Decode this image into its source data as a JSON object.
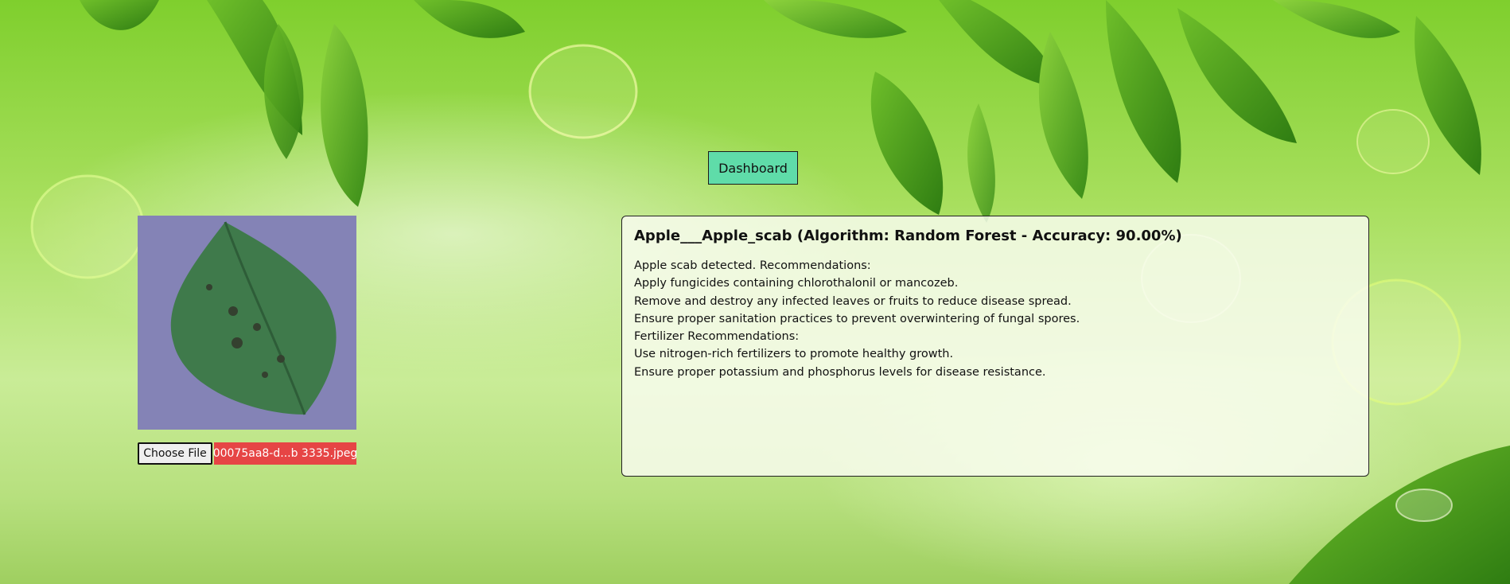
{
  "header": {
    "dashboard_label": "Dashboard"
  },
  "upload": {
    "choose_file_label": "Choose File",
    "file_name": "00075aa8-d...b 3335.jpeg"
  },
  "result": {
    "title": "Apple___Apple_scab (Algorithm: Random Forest - Accuracy: 90.00%)",
    "lines": [
      "Apple scab detected. Recommendations:",
      "Apply fungicides containing chlorothalonil or mancozeb.",
      "Remove and destroy any infected leaves or fruits to reduce disease spread.",
      "Ensure proper sanitation practices to prevent overwintering of fungal spores.",
      "Fertilizer Recommendations:",
      "Use nitrogen-rich fertilizers to promote healthy growth.",
      "Ensure proper potassium and phosphorus levels for disease resistance."
    ]
  },
  "colors": {
    "dashboard_button_bg": "#5fdca9",
    "file_name_bg": "#e64545",
    "background_green": "#8fd43d"
  }
}
